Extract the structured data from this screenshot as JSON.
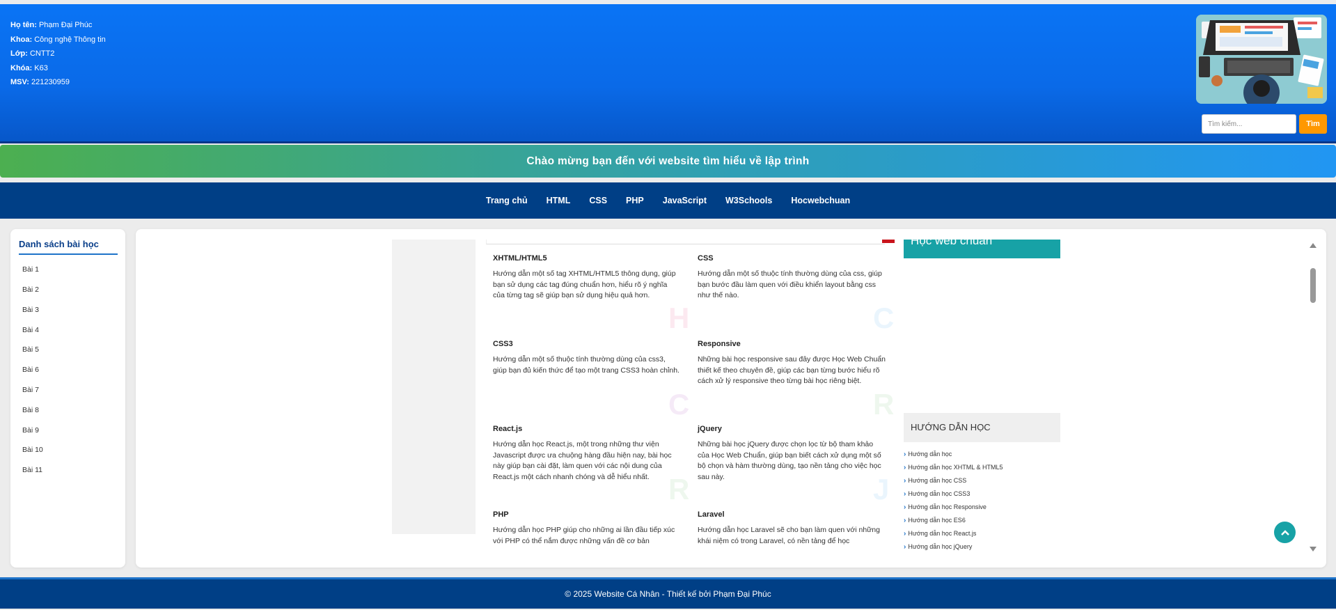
{
  "header": {
    "info": [
      {
        "label": "Họ tên:",
        "value": "Phạm Đại Phúc"
      },
      {
        "label": "Khoa:",
        "value": "Công nghệ Thông tin"
      },
      {
        "label": "Lớp:",
        "value": "CNTT2"
      },
      {
        "label": "Khóa:",
        "value": "K63"
      },
      {
        "label": "MSV:",
        "value": "221230959"
      }
    ],
    "search_placeholder": "Tìm kiếm...",
    "search_button": "Tìm"
  },
  "welcome": "Chào mừng bạn đến với website tìm hiểu về lập trình",
  "nav": [
    "Trang chủ",
    "HTML",
    "CSS",
    "PHP",
    "JavaScript",
    "W3Schools",
    "Hocwebchuan"
  ],
  "sidebar": {
    "title": "Danh sách bài học",
    "items": [
      "Bài 1",
      "Bài 2",
      "Bài 3",
      "Bài 4",
      "Bài 5",
      "Bài 6",
      "Bài 7",
      "Bài 8",
      "Bài 9",
      "Bài 10",
      "Bài 11"
    ]
  },
  "cards": [
    {
      "title": "XHTML/HTML5",
      "text": "Hướng dẫn một số tag XHTML/HTML5 thông dụng, giúp bạn sử dụng các tag đúng chuẩn hơn, hiểu rõ ý nghĩa của từng tag sẽ giúp bạn sử dụng hiệu quả hơn."
    },
    {
      "title": "CSS",
      "text": "Hướng dẫn một số thuộc tính thường dùng của css, giúp bạn bước đầu làm quen với điều khiển layout bằng css như thế nào."
    },
    {
      "title": "CSS3",
      "text": "Hướng dẫn một số thuộc tính thường dùng của css3, giúp bạn đủ kiến thức để tạo một trang CSS3 hoàn chỉnh."
    },
    {
      "title": "Responsive",
      "text": "Những bài học responsive sau đây được Học Web Chuẩn thiết kế theo chuyên đề, giúp các bạn từng bước hiểu rõ cách xử lý responsive theo từng bài học riêng biệt."
    },
    {
      "title": "React.js",
      "text": "Hướng dẫn học React.js, một trong những thư viện Javascript được ưa chuộng hàng đầu hiện nay, bài học này giúp bạn cài đặt, làm quen với các nội dung của React.js một cách nhanh chóng và dễ hiểu nhất."
    },
    {
      "title": "jQuery",
      "text": "Những bài học jQuery được chọn lọc từ bộ tham khảo của Học Web Chuẩn, giúp bạn biết cách xử dụng một số bộ chọn và hàm thường dùng, tạo nền tảng cho việc học sau này."
    },
    {
      "title": "PHP",
      "text": "Hướng dẫn học PHP giúp cho những ai lần đầu tiếp xúc với PHP có thể nắm được những vấn đề cơ bản"
    },
    {
      "title": "Laravel",
      "text": "Hướng dẫn học Laravel sẽ cho bạn làm quen với những khái niệm có trong Laravel, có nền tảng để học"
    }
  ],
  "watermarks": [
    "H",
    "C",
    "C",
    "R",
    "R",
    "J"
  ],
  "right": {
    "teal_title": "Học web chuẩn",
    "guide_title": "HƯỚNG DẪN HỌC",
    "guide_items": [
      "Hướng dẫn học",
      "Hướng dẫn học XHTML & HTML5",
      "Hướng dẫn học CSS",
      "Hướng dẫn học CSS3",
      "Hướng dẫn học Responsive",
      "Hướng dẫn học ES6",
      "Hướng dẫn học React.js",
      "Hướng dẫn học jQuery"
    ]
  },
  "footer": "© 2025 Website Cá Nhân - Thiết kế bởi Phạm Đại Phúc",
  "colors": {
    "header": "#0a6ae8",
    "nav": "#003f86",
    "accent_orange": "#ff9800",
    "teal": "#17a2a6"
  }
}
